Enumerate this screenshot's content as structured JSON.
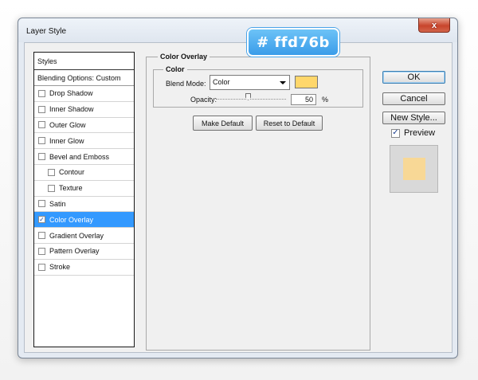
{
  "window": {
    "title": "Layer Style",
    "close_label": "x"
  },
  "styles_list": {
    "header": "Styles",
    "blending_options": "Blending Options: Custom",
    "items": [
      {
        "label": "Drop Shadow",
        "checked": false,
        "sub": false,
        "active": false
      },
      {
        "label": "Inner Shadow",
        "checked": false,
        "sub": false,
        "active": false
      },
      {
        "label": "Outer Glow",
        "checked": false,
        "sub": false,
        "active": false
      },
      {
        "label": "Inner Glow",
        "checked": false,
        "sub": false,
        "active": false
      },
      {
        "label": "Bevel and Emboss",
        "checked": false,
        "sub": false,
        "active": false
      },
      {
        "label": "Contour",
        "checked": false,
        "sub": true,
        "active": false
      },
      {
        "label": "Texture",
        "checked": false,
        "sub": true,
        "active": false
      },
      {
        "label": "Satin",
        "checked": false,
        "sub": false,
        "active": false
      },
      {
        "label": "Color Overlay",
        "checked": true,
        "sub": false,
        "active": true
      },
      {
        "label": "Gradient Overlay",
        "checked": false,
        "sub": false,
        "active": false
      },
      {
        "label": "Pattern Overlay",
        "checked": false,
        "sub": false,
        "active": false
      },
      {
        "label": "Stroke",
        "checked": false,
        "sub": false,
        "active": false
      }
    ]
  },
  "panel": {
    "group_title": "Color Overlay",
    "subgroup_title": "Color",
    "blend_mode_label": "Blend Mode:",
    "blend_mode_value": "Color",
    "opacity_label": "Opacity:",
    "opacity_value": "50",
    "opacity_unit": "%",
    "overlay_color": "#ffd76b",
    "make_default": "Make Default",
    "reset_default": "Reset to Default"
  },
  "callout": {
    "text": "# ffd76b"
  },
  "actions": {
    "ok": "OK",
    "cancel": "Cancel",
    "new_style": "New Style...",
    "preview_label": "Preview",
    "preview_checked": true
  },
  "preview": {
    "swatch_color": "#f8d896"
  }
}
